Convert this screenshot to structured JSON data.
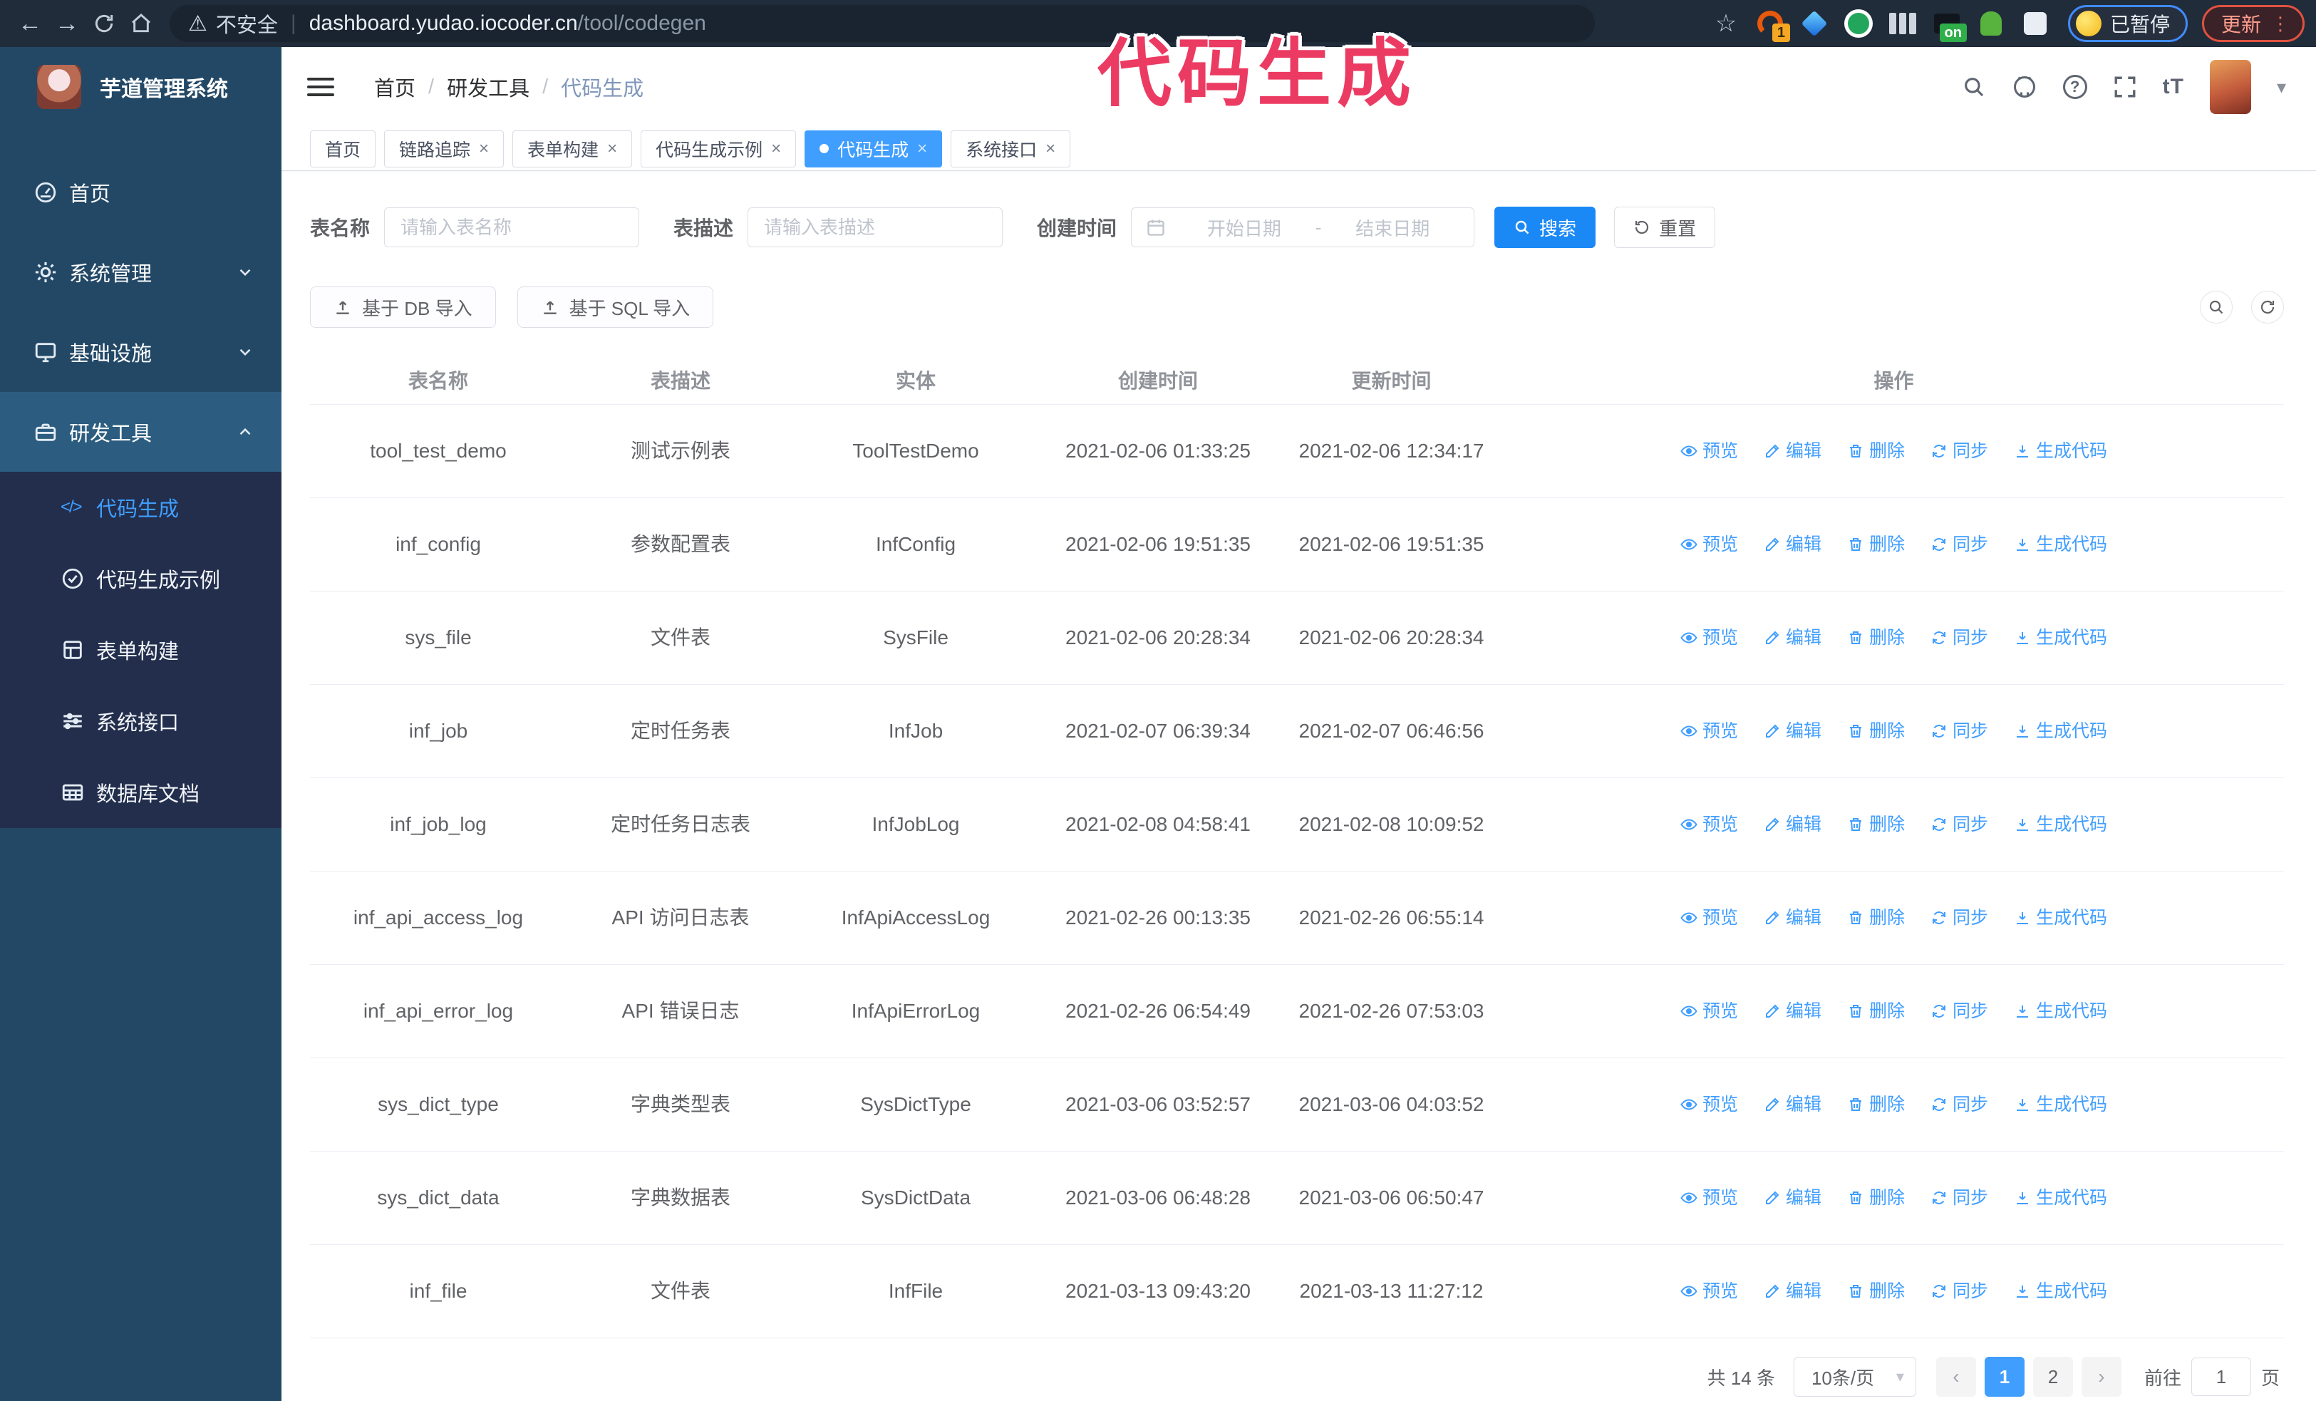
{
  "annotation": {
    "text": "代码生成"
  },
  "browser": {
    "security_label": "不安全",
    "url_separator": "|",
    "url_domain": "dashboard.yudao.iocoder.cn",
    "url_path": "/tool/codegen",
    "extension_badge": "1",
    "extension_on_badge": "on",
    "paused_badge": "已暂停",
    "update_button": "更新"
  },
  "icons": {
    "back": "←",
    "forward": "→",
    "star": "☆",
    "warning": "⚠",
    "caret_down": "▾",
    "close": "×",
    "active_dot": "●",
    "separator": "/",
    "question": "?",
    "font_size": "tT",
    "overflow_dots": "⋮",
    "range_separator": "-",
    "code_glyph": "</>"
  },
  "app": {
    "title": "芋道管理系统",
    "breadcrumb": [
      "首页",
      "研发工具",
      "代码生成"
    ]
  },
  "sidebar": {
    "items": [
      {
        "label": "首页",
        "icon": "gauge"
      },
      {
        "label": "系统管理",
        "icon": "gear",
        "chevron": "down"
      },
      {
        "label": "基础设施",
        "icon": "monitor",
        "chevron": "down"
      },
      {
        "label": "研发工具",
        "icon": "toolbox",
        "chevron": "up",
        "expanded": true,
        "children": [
          {
            "label": "代码生成",
            "icon": "code",
            "active": true
          },
          {
            "label": "代码生成示例",
            "icon": "example"
          },
          {
            "label": "表单构建",
            "icon": "form"
          },
          {
            "label": "系统接口",
            "icon": "api"
          },
          {
            "label": "数据库文档",
            "icon": "dbdoc"
          }
        ]
      }
    ]
  },
  "tabs": [
    {
      "label": "首页",
      "closable": false
    },
    {
      "label": "链路追踪",
      "closable": true
    },
    {
      "label": "表单构建",
      "closable": true
    },
    {
      "label": "代码生成示例",
      "closable": true
    },
    {
      "label": "代码生成",
      "closable": true,
      "active": true
    },
    {
      "label": "系统接口",
      "closable": true
    }
  ],
  "filters": {
    "name_label": "表名称",
    "name_placeholder": "请输入表名称",
    "desc_label": "表描述",
    "desc_placeholder": "请输入表描述",
    "time_label": "创建时间",
    "start_placeholder": "开始日期",
    "end_placeholder": "结束日期",
    "search_label": "搜索",
    "reset_label": "重置"
  },
  "toolbar": {
    "import_db_label": "基于 DB 导入",
    "import_sql_label": "基于 SQL 导入"
  },
  "table": {
    "columns": [
      "表名称",
      "表描述",
      "实体",
      "创建时间",
      "更新时间",
      "操作"
    ],
    "actions": [
      "预览",
      "编辑",
      "删除",
      "同步",
      "生成代码"
    ],
    "rows": [
      {
        "name": "tool_test_demo",
        "desc": "测试示例表",
        "entity": "ToolTestDemo",
        "created": "2021-02-06 01:33:25",
        "updated": "2021-02-06 12:34:17"
      },
      {
        "name": "inf_config",
        "desc": "参数配置表",
        "entity": "InfConfig",
        "created": "2021-02-06 19:51:35",
        "updated": "2021-02-06 19:51:35"
      },
      {
        "name": "sys_file",
        "desc": "文件表",
        "entity": "SysFile",
        "created": "2021-02-06 20:28:34",
        "updated": "2021-02-06 20:28:34"
      },
      {
        "name": "inf_job",
        "desc": "定时任务表",
        "entity": "InfJob",
        "created": "2021-02-07 06:39:34",
        "updated": "2021-02-07 06:46:56"
      },
      {
        "name": "inf_job_log",
        "desc": "定时任务日志表",
        "entity": "InfJobLog",
        "created": "2021-02-08 04:58:41",
        "updated": "2021-02-08 10:09:52"
      },
      {
        "name": "inf_api_access_log",
        "desc": "API 访问日志表",
        "entity": "InfApiAccessLog",
        "created": "2021-02-26 00:13:35",
        "updated": "2021-02-26 06:55:14"
      },
      {
        "name": "inf_api_error_log",
        "desc": "API 错误日志",
        "entity": "InfApiErrorLog",
        "created": "2021-02-26 06:54:49",
        "updated": "2021-02-26 07:53:03"
      },
      {
        "name": "sys_dict_type",
        "desc": "字典类型表",
        "entity": "SysDictType",
        "created": "2021-03-06 03:52:57",
        "updated": "2021-03-06 04:03:52"
      },
      {
        "name": "sys_dict_data",
        "desc": "字典数据表",
        "entity": "SysDictData",
        "created": "2021-03-06 06:48:28",
        "updated": "2021-03-06 06:50:47"
      },
      {
        "name": "inf_file",
        "desc": "文件表",
        "entity": "InfFile",
        "created": "2021-03-13 09:43:20",
        "updated": "2021-03-13 11:27:12"
      }
    ]
  },
  "pagination": {
    "total": "共 14 条",
    "page_size": "10条/页",
    "pages": [
      "1",
      "2"
    ],
    "current": "1",
    "goto_label": "前往",
    "goto_value": "1",
    "page_suffix": "页"
  },
  "colors": {
    "primary": "#409eff",
    "search_button": "#1b89f5",
    "annotation": "#ec3b62",
    "sidebar_bg": "#234866",
    "submenu_bg": "#222e4c",
    "expanded_item_bg": "#2c5d80",
    "browser_bar_bg": "#212c3a",
    "paused_border": "#3f8cff",
    "update_border": "#e0523f"
  }
}
